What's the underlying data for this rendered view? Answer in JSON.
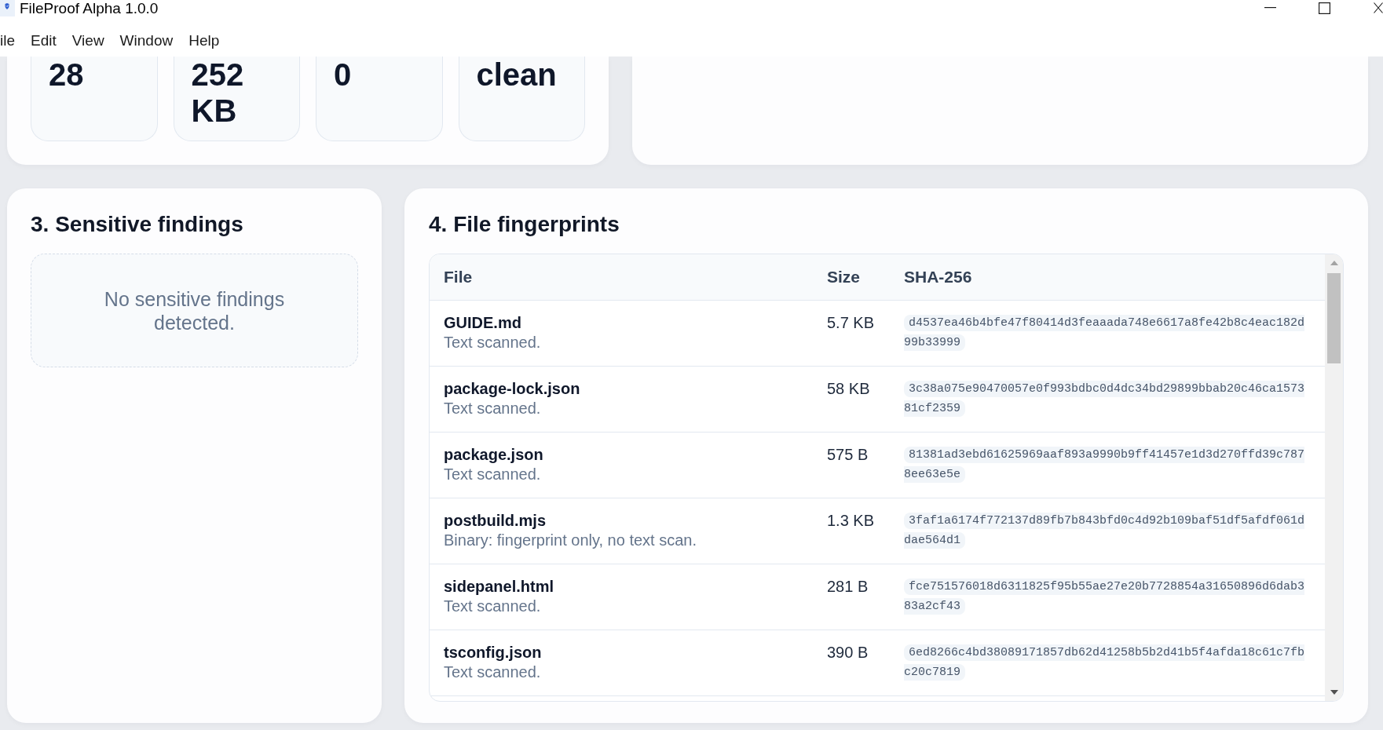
{
  "window": {
    "title": "FileProof Alpha 1.0.0"
  },
  "menu": [
    "ile",
    "Edit",
    "View",
    "Window",
    "Help"
  ],
  "stats": [
    "28",
    "252 KB",
    "0",
    "clean"
  ],
  "sensitive_findings": {
    "title": "3. Sensitive findings",
    "empty_message": "No sensitive findings detected."
  },
  "file_fingerprints": {
    "title": "4. File fingerprints",
    "columns": [
      "File",
      "Size",
      "SHA-256"
    ],
    "rows": [
      {
        "file": "GUIDE.md",
        "note": "Text scanned.",
        "size": "5.7 KB",
        "sha256": "d4537ea46b4bfe47f80414d3feaaada748e6617a8fe42b8c4eac182d99b33999"
      },
      {
        "file": "package-lock.json",
        "note": "Text scanned.",
        "size": "58 KB",
        "sha256": "3c38a075e90470057e0f993bdbc0d4dc34bd29899bbab20c46ca157381cf2359"
      },
      {
        "file": "package.json",
        "note": "Text scanned.",
        "size": "575 B",
        "sha256": "81381ad3ebd61625969aaf893a9990b9ff41457e1d3d270ffd39c7878ee63e5e"
      },
      {
        "file": "postbuild.mjs",
        "note": "Binary: fingerprint only, no text scan.",
        "size": "1.3 KB",
        "sha256": "3faf1a6174f772137d89fb7b843bfd0c4d92b109baf51df5afdf061ddae564d1"
      },
      {
        "file": "sidepanel.html",
        "note": "Text scanned.",
        "size": "281 B",
        "sha256": "fce751576018d6311825f95b55ae27e20b7728854a31650896d6dab383a2cf43"
      },
      {
        "file": "tsconfig.json",
        "note": "Text scanned.",
        "size": "390 B",
        "sha256": "6ed8266c4bd38089171857db62d41258b5b2d41b5f4afda18c61c7fbc20c7819"
      }
    ]
  }
}
